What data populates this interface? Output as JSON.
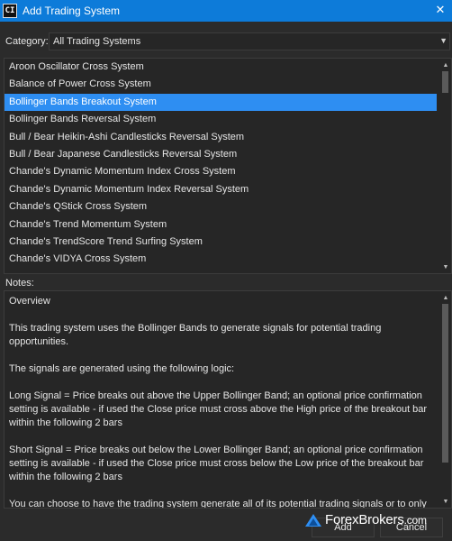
{
  "window": {
    "title": "Add Trading System",
    "app_icon_text": "CI"
  },
  "category": {
    "label": "Category:",
    "value": "All Trading Systems"
  },
  "systems": {
    "items": [
      "Aroon Oscillator Cross System",
      "Balance of Power Cross System",
      "Bollinger Bands Breakout System",
      "Bollinger Bands Reversal System",
      "Bull / Bear Heikin-Ashi Candlesticks Reversal System",
      "Bull / Bear Japanese Candlesticks Reversal System",
      "Chande's Dynamic Momentum Index Cross System",
      "Chande's Dynamic Momentum Index Reversal System",
      "Chande's QStick Cross System",
      "Chande's Trend Momentum System",
      "Chande's TrendScore Trend Surfing System",
      "Chande's VIDYA Cross System"
    ],
    "selected": "Bollinger Bands Breakout System"
  },
  "notes": {
    "label": "Notes:",
    "paragraphs": [
      "Overview",
      "This trading system uses the Bollinger Bands to generate signals for potential trading opportunities.",
      "The signals are generated using the following logic:",
      "Long Signal = Price breaks out above the Upper Bollinger Band; an optional price confirmation setting is available - if used the Close price must cross above the High price of the breakout bar within the following 2 bars",
      "Short Signal = Price breaks out below the Lower Bollinger Band; an optional price confirmation setting is available - if used the Close price must cross below the Low price of the breakout bar within the following 2 bars",
      "You can choose to have the trading system generate all of its potential trading signals or to only generate signals like an \"always in the market\" system."
    ]
  },
  "buttons": {
    "add": "Add",
    "cancel": "Cancel"
  },
  "watermark": {
    "brand": "ForexBrokers",
    "suffix": ".com"
  },
  "colors": {
    "titlebar": "#0d7bd9",
    "selection": "#2e8ef2",
    "background": "#2b2b2b"
  }
}
